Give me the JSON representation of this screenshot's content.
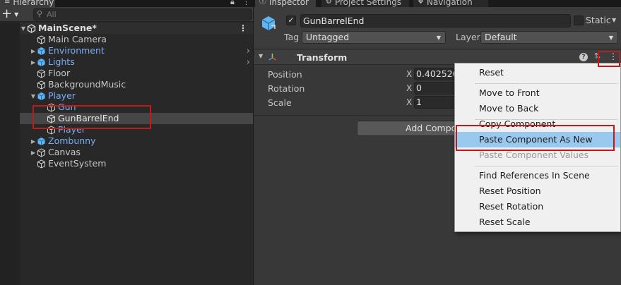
{
  "hierarchy": {
    "tab_label": "Hierarchy",
    "search_placeholder": "All",
    "add_label": "+",
    "scene": {
      "label": "MainScene*"
    },
    "items": [
      {
        "label": "Main Camera",
        "prefab": false,
        "expand": ""
      },
      {
        "label": "Environment",
        "prefab": true,
        "expand": "▶"
      },
      {
        "label": "Lights",
        "prefab": true,
        "expand": "▶"
      },
      {
        "label": "Floor",
        "prefab": false,
        "expand": ""
      },
      {
        "label": "BackgroundMusic",
        "prefab": false,
        "expand": ""
      },
      {
        "label": "Player",
        "prefab": true,
        "expand": "▼"
      },
      {
        "label": "Gun",
        "prefab": true,
        "expand": ""
      },
      {
        "label": "GunBarrelEnd",
        "prefab": false,
        "expand": ""
      },
      {
        "label": "Player",
        "prefab": true,
        "expand": ""
      },
      {
        "label": "Zombunny",
        "prefab": true,
        "expand": "▶"
      },
      {
        "label": "Canvas",
        "prefab": false,
        "expand": "▶"
      },
      {
        "label": "EventSystem",
        "prefab": false,
        "expand": ""
      }
    ]
  },
  "inspector": {
    "tabs": [
      {
        "label": "Inspector"
      },
      {
        "label": "Project Settings"
      },
      {
        "label": "Navigation"
      }
    ],
    "object_name": "GunBarrelEnd",
    "static_label": "Static",
    "tag_label": "Tag",
    "tag_value": "Untagged",
    "layer_label": "Layer",
    "layer_value": "Default",
    "component_title": "Transform",
    "properties": [
      {
        "label": "Position",
        "axis": "X",
        "value": "0.402526"
      },
      {
        "label": "Rotation",
        "axis": "X",
        "value": "0"
      },
      {
        "label": "Scale",
        "axis": "X",
        "value": "1"
      }
    ],
    "add_component_label": "Add Component"
  },
  "context_menu": {
    "items": [
      {
        "label": "Reset",
        "state": "normal"
      },
      {
        "label": "Move to Front",
        "state": "normal"
      },
      {
        "label": "Move to Back",
        "state": "normal"
      },
      {
        "label": "Copy Component",
        "state": "normal"
      },
      {
        "label": "Paste Component As New",
        "state": "highlighted"
      },
      {
        "label": "Paste Component Values",
        "state": "disabled"
      },
      {
        "label": "Find References In Scene",
        "state": "normal"
      },
      {
        "label": "Reset Position",
        "state": "normal"
      },
      {
        "label": "Reset Rotation",
        "state": "normal"
      },
      {
        "label": "Reset Scale",
        "state": "normal"
      }
    ]
  },
  "colors": {
    "prefab_label": "#7aaef5",
    "annotation_red": "#c11a1a",
    "menu_highlight": "#99c9ef",
    "panel_bg": "#282828"
  }
}
